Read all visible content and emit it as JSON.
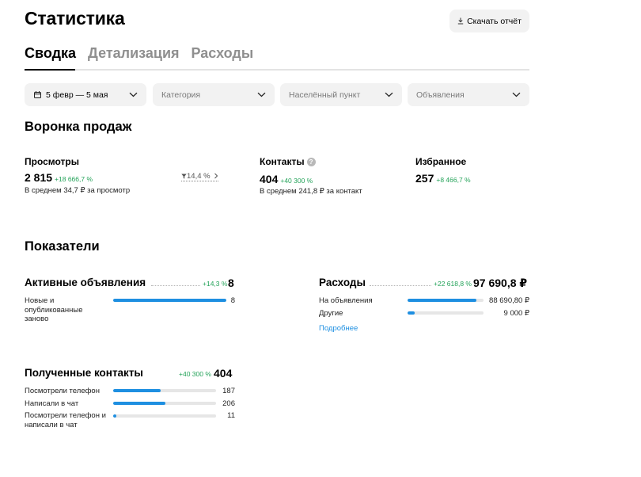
{
  "page": {
    "title": "Статистика",
    "download_label": "Скачать отчёт"
  },
  "tabs": [
    {
      "label": "Сводка",
      "active": true
    },
    {
      "label": "Детализация",
      "active": false
    },
    {
      "label": "Расходы",
      "active": false
    }
  ],
  "filters": {
    "period": "5 февр — 5 мая",
    "category": "Категория",
    "location": "Населённый пункт",
    "ads": "Объявления"
  },
  "funnel": {
    "title": "Воронка продаж",
    "views": {
      "label": "Просмотры",
      "value": "2 815",
      "delta": "+18 666,7 %",
      "sub": "В среднем 34,7 ₽ за просмотр",
      "conversion": "14,4 %"
    },
    "contacts": {
      "label": "Контакты",
      "help": "?",
      "value": "404",
      "delta": "+40 300 %",
      "sub": "В среднем 241,8 ₽ за контакт"
    },
    "favorites": {
      "label": "Избранное",
      "value": "257",
      "delta": "+8 466,7 %"
    }
  },
  "indicators": {
    "title": "Показатели",
    "active_ads": {
      "title": "Активные объявления",
      "delta": "+14,3 %",
      "total": "8",
      "rows": [
        {
          "label": "Новые и опубликованные заново",
          "value": "8",
          "fill": 1.0
        }
      ]
    },
    "expenses": {
      "title": "Расходы",
      "delta": "+22 618,8 %",
      "total": "97 690,8 ₽",
      "rows": [
        {
          "label": "На объявления",
          "value": "88 690,80 ₽",
          "fill": 0.91
        },
        {
          "label": "Другие",
          "value": "9 000 ₽",
          "fill": 0.09
        }
      ],
      "more_link": "Подробнее"
    },
    "received_contacts": {
      "title": "Полученные контакты",
      "delta": "+40 300 %",
      "total": "404",
      "rows": [
        {
          "label": "Посмотрели телефон",
          "value": "187",
          "fill": 0.46
        },
        {
          "label": "Написали в чат",
          "value": "206",
          "fill": 0.51
        },
        {
          "label": "Посмотрели телефон и написали в чат",
          "value": "11",
          "fill": 0.03
        }
      ]
    }
  },
  "colors": {
    "accent": "#1e8fe1",
    "positive": "#25a35a",
    "chip_bg": "#f2f2f2"
  },
  "icons": {
    "download": "download-icon",
    "calendar": "calendar-icon",
    "chevron": "chevron-down-icon",
    "funnel": "funnel-icon",
    "help": "help-icon"
  }
}
